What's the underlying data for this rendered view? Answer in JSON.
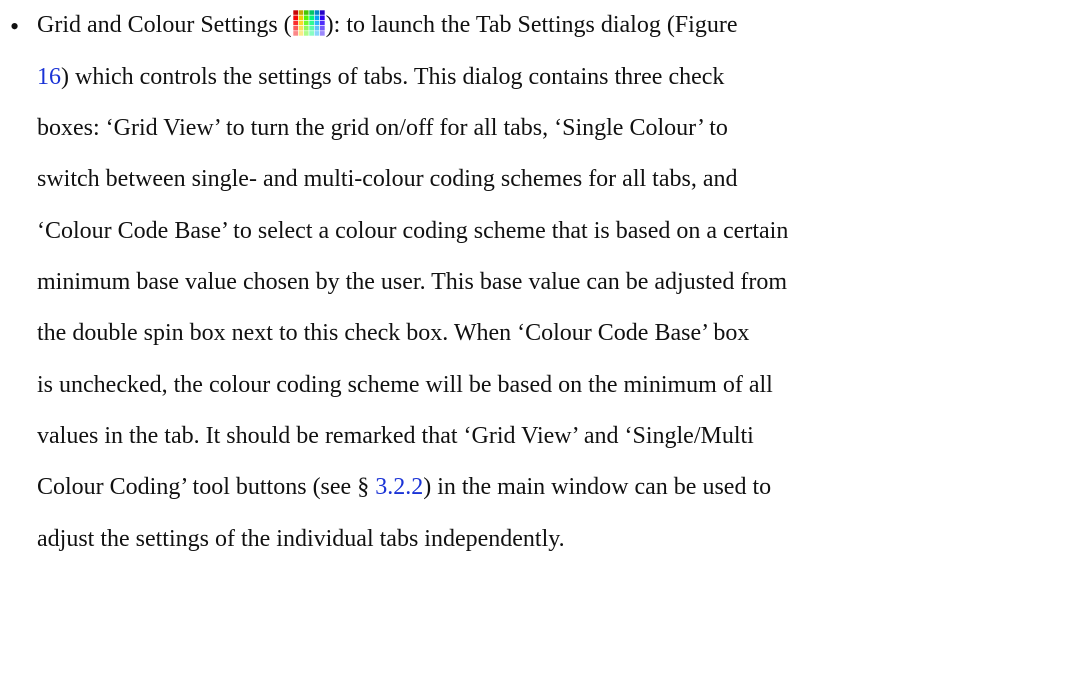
{
  "bullet": "•",
  "lines": [
    {
      "pre": "Grid and Colour Settings (",
      "icon": "grid-colour-settings-icon",
      "post": "):  to launch the Tab Settings dialog (Figure"
    },
    {
      "ref": "16",
      "post": ") which controls the settings of tabs.  This dialog contains three check"
    },
    {
      "text": "boxes:  ‘Grid View’ to turn the grid on/off for all tabs, ‘Single Colour’ to"
    },
    {
      "text": "switch between single- and multi-colour coding schemes for all tabs, and"
    },
    {
      "text": "‘Colour Code Base’ to select a colour coding scheme that is based on a certain"
    },
    {
      "text": "minimum base value chosen by the user.  This base value can be adjusted from"
    },
    {
      "text": "the double spin box next to this check box.  When ‘Colour Code Base’ box"
    },
    {
      "text": "is unchecked, the colour coding scheme will be based on the minimum of all"
    },
    {
      "text": "values in the tab.  It should be remarked that ‘Grid View’ and ‘Single/Multi"
    },
    {
      "pre": "Colour Coding’ tool buttons (see § ",
      "ref": "3.2.2",
      "post": ") in the main window can be used to"
    },
    {
      "text": "adjust the settings of the individual tabs independently."
    }
  ],
  "colors": {
    "text": "#111111",
    "link": "#1a33d6"
  }
}
